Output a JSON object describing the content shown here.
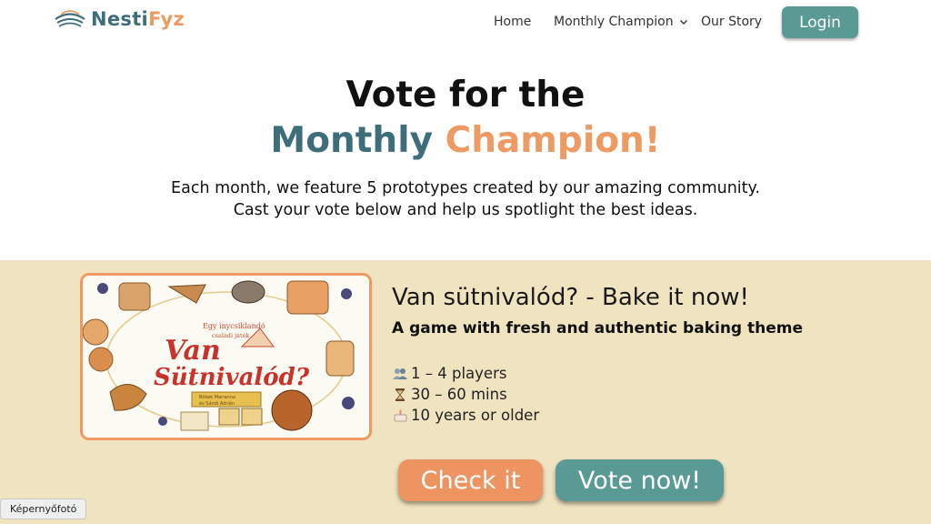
{
  "header": {
    "logo": {
      "part1": "Nesti",
      "part2": "Fyz"
    },
    "nav": {
      "home": "Home",
      "champion": "Monthly Champion",
      "story": "Our Story"
    },
    "login_label": "Login"
  },
  "hero": {
    "title_line1": "Vote for the",
    "title_word1": "Monthly",
    "title_word2": "Champion!",
    "subtitle_line1": "Each month, we feature 5 prototypes created by our amazing community.",
    "subtitle_line2": "Cast your vote below and help us spotlight the best ideas."
  },
  "game": {
    "cover": {
      "top_text_line1": "Egy ínycsiklandó",
      "top_text_line2": "családi játék",
      "title_line1": "Van",
      "title_line2": "Sütnivalód?",
      "authors_line1": "Bökek Marianna",
      "authors_line2": "és Sándi Adrián"
    },
    "title": "Van sütnivalód? - Bake it now!",
    "subtitle": "A game with fresh and authentic baking theme",
    "players_icon": "players-icon",
    "players": "1 – 4 players",
    "time_icon": "hourglass-icon",
    "time": "30 – 60 mins",
    "age_icon": "cake-icon",
    "age": "10 years or older",
    "check_label": "Check it",
    "vote_label": "Vote now!"
  },
  "tooltip": "Képernyőfotó",
  "colors": {
    "teal": "#5a9a95",
    "orange": "#ee9460",
    "band": "#f0e3c0",
    "logo_teal": "#3e6e7a"
  }
}
